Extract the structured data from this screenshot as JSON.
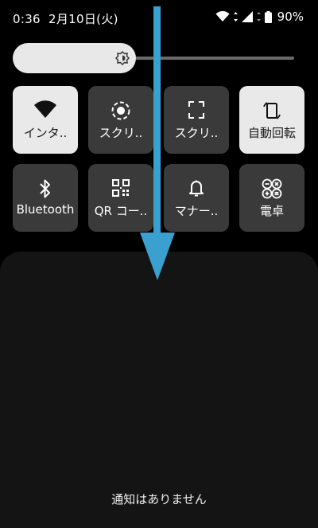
{
  "status": {
    "time": "0:36",
    "date": "2月10日(火)",
    "battery": "90%"
  },
  "brightness": {
    "level": 0.41
  },
  "tiles": [
    {
      "label": "インタ..",
      "icon": "wifi-icon",
      "active": true
    },
    {
      "label": "スクリ..",
      "icon": "screen-record-icon",
      "active": false
    },
    {
      "label": "スクリ..",
      "icon": "screenshot-icon",
      "active": false
    },
    {
      "label": "自動回転",
      "icon": "auto-rotate-icon",
      "active": true
    },
    {
      "label": "Bluetooth",
      "icon": "bluetooth-icon",
      "active": false
    },
    {
      "label": "QR コー..",
      "icon": "qr-code-icon",
      "active": false
    },
    {
      "label": "マナー..",
      "icon": "bell-icon",
      "active": false
    },
    {
      "label": "電卓",
      "icon": "calculator-icon",
      "active": false
    }
  ],
  "notifications": {
    "empty_text": "通知はありません"
  },
  "colors": {
    "arrow": "#3aa0cf",
    "tile_on": "#e9e9e9",
    "tile_off": "#3a3a3a"
  }
}
